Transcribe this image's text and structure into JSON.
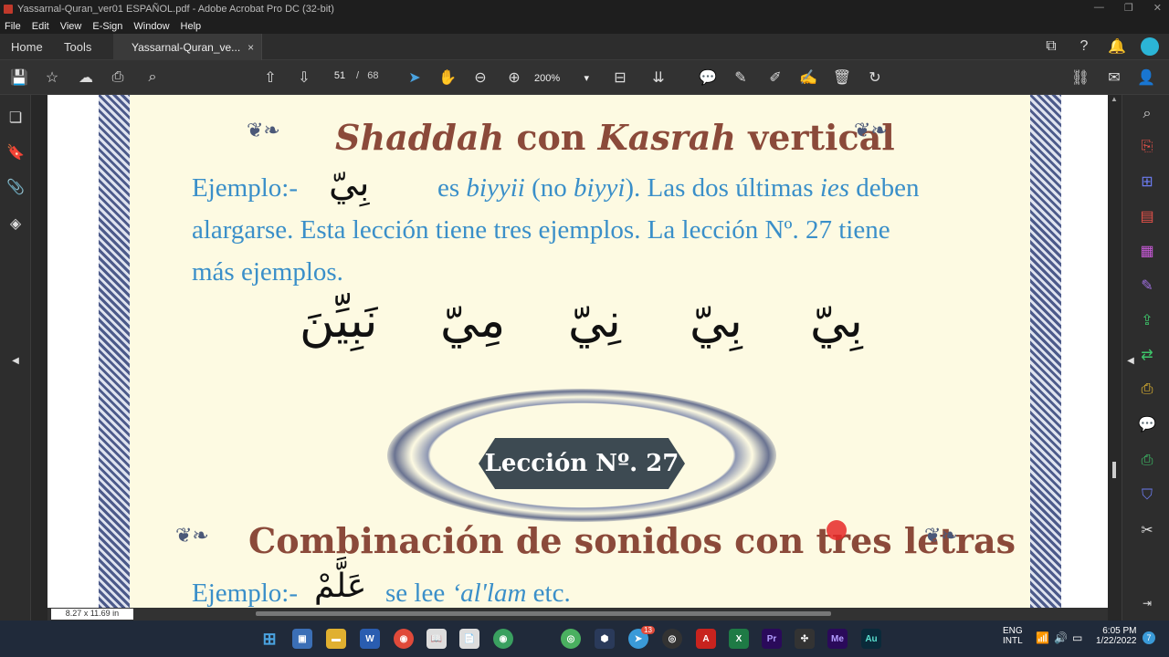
{
  "window": {
    "title": "Yassarnal-Quran_ver01 ESPAÑOL.pdf - Adobe Acrobat Pro DC (32-bit)"
  },
  "menu": [
    "File",
    "Edit",
    "View",
    "E-Sign",
    "Window",
    "Help"
  ],
  "tabs": {
    "home": "Home",
    "tools": "Tools",
    "doc": "Yassarnal-Quran_ve...",
    "close": "×"
  },
  "toolbar": {
    "page_current": "51",
    "page_sep": "/",
    "page_total": "68",
    "zoom": "200%",
    "zoom_arrow": "▾"
  },
  "doc": {
    "title1_a": "Shaddah",
    "title1_b": " con ",
    "title1_c": "Kasrah",
    "title1_d": " vertical",
    "example_label": "Ejemplo:-",
    "example_arabic": "بِيّ",
    "line1": "es biyyii (no biyyi). Las dos últimas ies deben",
    "line1_a": "es ",
    "line1_b": "biyyii",
    "line1_c": " (no ",
    "line1_d": "biyyi",
    "line1_e": "). Las dos últimas ",
    "line1_f": "ies",
    "line1_g": " deben",
    "line2": "alargarse. Esta lección tiene tres ejemplos. La lección Nº. 27 tiene",
    "line3": "más ejemplos.",
    "arabic_words": [
      "بِيّ",
      "بِيّ",
      "نِيّ",
      "مِيّ",
      "نَبِيِّنَ"
    ],
    "lesson_badge": "Lección Nº. 27",
    "title2": "Combinación de sonidos con tres letras",
    "example2_label": "Ejemplo:-",
    "example2_arabic": "عَلَّمْ",
    "example2_a": "se lee ",
    "example2_b": "‘al'lam",
    "example2_c": " etc."
  },
  "status": {
    "page_size": "8.27 x 11.69 in"
  },
  "tray": {
    "lang1": "ENG",
    "lang2": "INTL",
    "time": "6:05 PM",
    "date": "1/22/2022",
    "badge": "7",
    "telegram_badge": "13"
  },
  "colors": {
    "heading": "#8b4a3a",
    "body": "#3a8fc9",
    "page_bg": "#fdfae2"
  }
}
